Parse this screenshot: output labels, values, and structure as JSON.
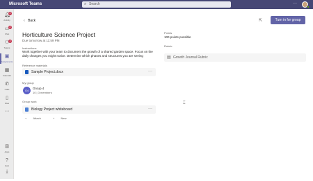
{
  "app": {
    "title": "Microsoft Teams"
  },
  "search": {
    "placeholder": "Search",
    "icon": "search-icon"
  },
  "titlebar": {
    "more": "···"
  },
  "rail": {
    "items": [
      {
        "label": "Activity",
        "icon": "bell-icon",
        "badge": "4"
      },
      {
        "label": "Chat",
        "icon": "chat-icon",
        "badge": "2"
      },
      {
        "label": "Teams",
        "icon": "teams-icon",
        "badge": "3"
      },
      {
        "label": "Assignments",
        "icon": "assignments-icon",
        "active": true
      },
      {
        "label": "Calendar",
        "icon": "calendar-icon"
      },
      {
        "label": "Calls",
        "icon": "phone-icon"
      },
      {
        "label": "Files",
        "icon": "file-icon"
      },
      {
        "label": "···",
        "icon": "more-icon"
      },
      {
        "label": "Apps",
        "icon": "apps-icon"
      },
      {
        "label": "Help",
        "icon": "help-icon"
      },
      {
        "label": "",
        "icon": "download-icon"
      }
    ]
  },
  "header": {
    "back_label": "Back",
    "turn_in_label": "Turn in for group"
  },
  "assignment": {
    "title": "Horticulture Science Project",
    "due": "Due tomorrow at 11:59 PM",
    "instructions_label": "Instructions",
    "instructions": "Work together with your team to document the growth of a shared garden space. Focus on the daily changes you might notice. Determine which phases and structures you are seeing",
    "reference_label": "Reference materials",
    "reference_file": "Sample Project.docx",
    "group_label": "My group",
    "group_name": "Group 4",
    "group_members": "10 | 3 members",
    "group_avatar": "G4",
    "group_work_label": "Group work",
    "group_work_file": "Biology Project whiteboard",
    "attach_label": "Attach",
    "new_label": "New",
    "points_label": "Points",
    "points_value": "100 points possible",
    "rubric_label": "Rubric",
    "rubric_name": "Growth Journal Rubric"
  },
  "colors": {
    "brand": "#464775",
    "accent": "#6264a7",
    "word": "#185abd",
    "whiteboard": "#4a7fd4"
  }
}
